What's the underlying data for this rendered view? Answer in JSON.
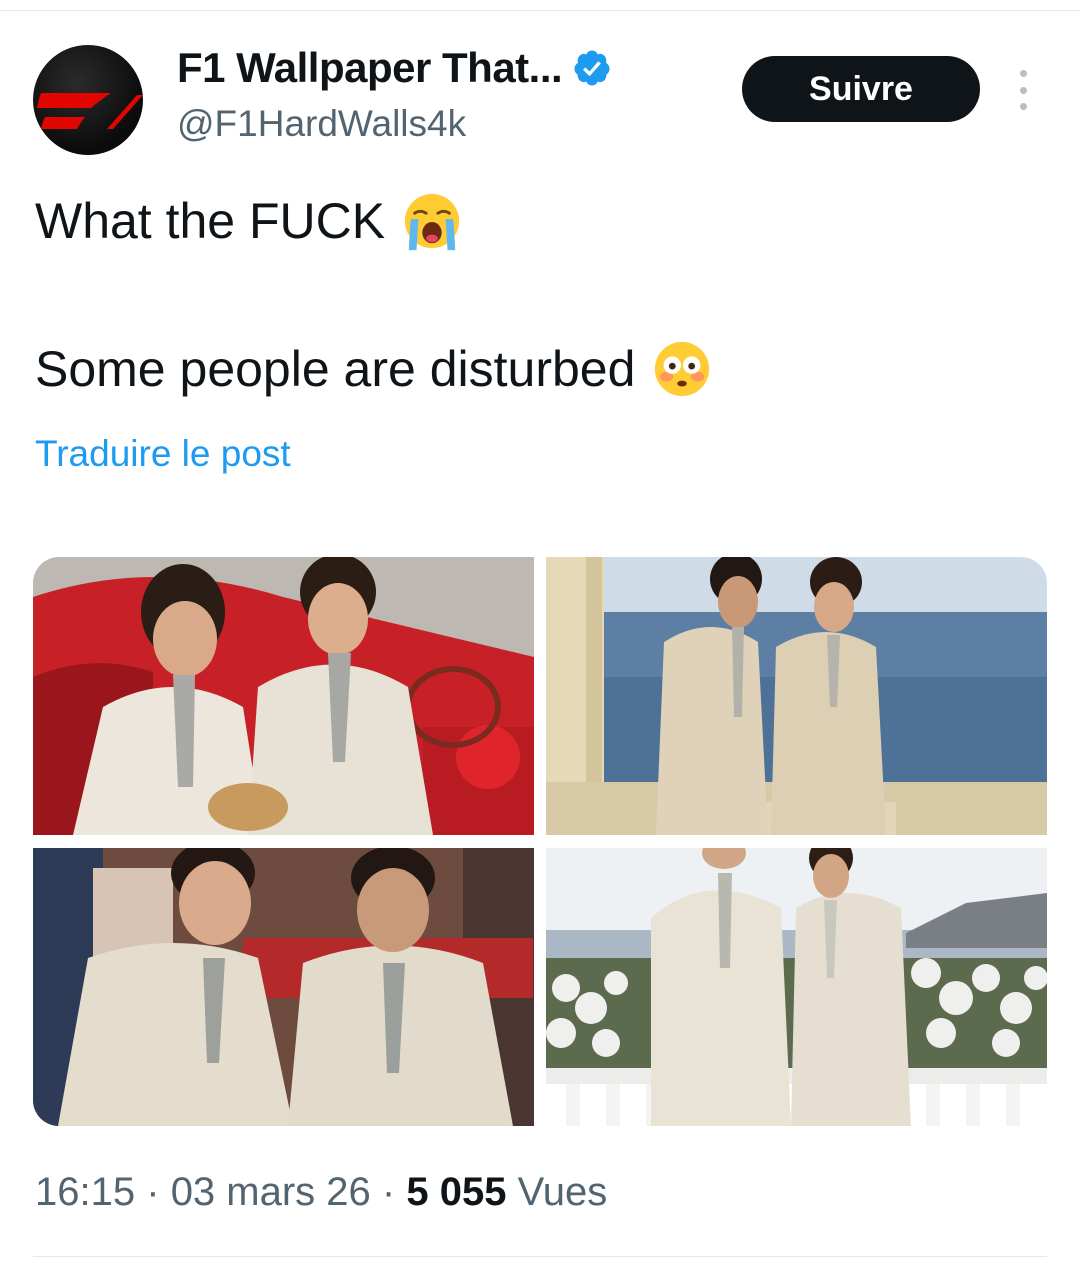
{
  "author": {
    "display_name": "F1 Wallpaper That...",
    "handle": "@F1HardWalls4k",
    "verified": true,
    "avatar_icon": "f1-logo-icon"
  },
  "actions": {
    "follow_label": "Suivre",
    "more_icon": "more-vertical-icon"
  },
  "post": {
    "line1": "What the FUCK",
    "line1_emoji": "loudly-crying-face-icon",
    "line2": "Some people are disturbed",
    "line2_emoji": "flushed-face-icon",
    "translate_label": "Traduire le post"
  },
  "media": {
    "photos": [
      "two men in beige suits in a red vintage convertible",
      "two men in beige suits on a balcony by the sea",
      "two smiling men in beige suits seated at an event",
      "two men in beige suits standing on a terrace with flowers"
    ]
  },
  "meta": {
    "time": "16:15",
    "sep1": "·",
    "date": "03 mars 26",
    "sep2": "·",
    "views_count": "5 055",
    "views_label": "Vues"
  },
  "colors": {
    "accent_link": "#1d9bf0",
    "verified": "#1d9bf0",
    "button_bg": "#0f1419",
    "secondary_text": "#536471"
  }
}
